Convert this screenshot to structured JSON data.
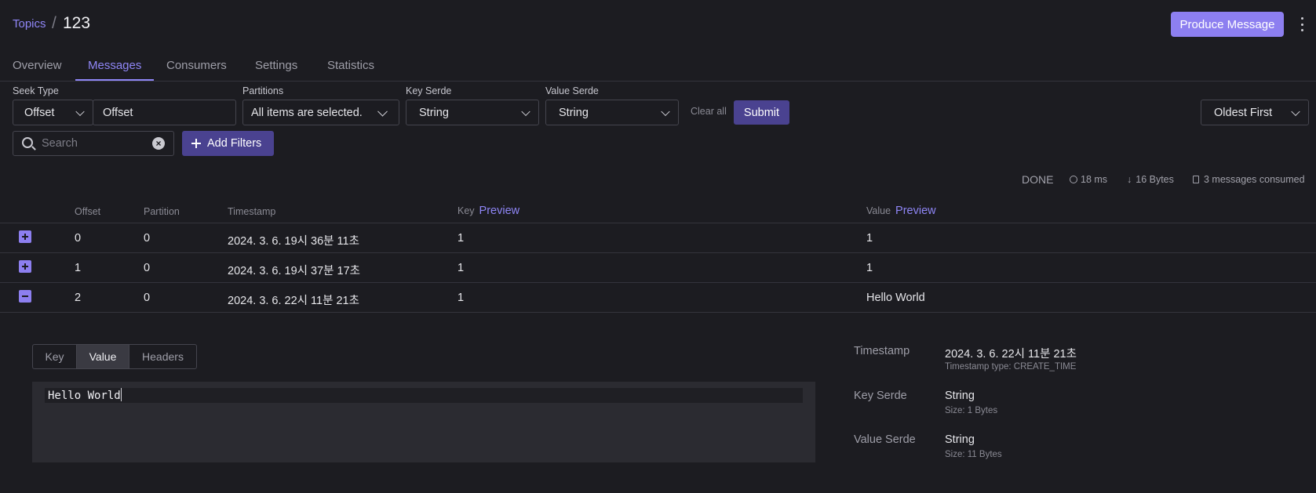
{
  "breadcrumb": {
    "parent": "Topics",
    "separator": "/",
    "current": "123"
  },
  "header": {
    "produce_label": "Produce Message"
  },
  "tabs": [
    "Overview",
    "Messages",
    "Consumers",
    "Settings",
    "Statistics"
  ],
  "active_tab": "Messages",
  "filters": {
    "seek_type_label": "Seek Type",
    "seek_type_value": "Offset",
    "offset_value": "Offset",
    "partitions_label": "Partitions",
    "partitions_value": "All items are selected.",
    "key_serde_label": "Key Serde",
    "key_serde_value": "String",
    "value_serde_label": "Value Serde",
    "value_serde_value": "String",
    "clear_all": "Clear all",
    "submit": "Submit",
    "sort_value": "Oldest First",
    "search_placeholder": "Search",
    "add_filters": "Add Filters"
  },
  "stats": {
    "status": "DONE",
    "elapsed": "18 ms",
    "bytes": "16 Bytes",
    "consumed": "3 messages consumed"
  },
  "table": {
    "headers": {
      "offset": "Offset",
      "partition": "Partition",
      "timestamp": "Timestamp",
      "key": "Key",
      "value": "Value",
      "preview": "Preview"
    },
    "rows": [
      {
        "offset": "0",
        "partition": "0",
        "timestamp": "2024. 3. 6. 19시 36분 11초",
        "key": "1",
        "value": "1",
        "expanded": false
      },
      {
        "offset": "1",
        "partition": "0",
        "timestamp": "2024. 3. 6. 19시 37분 17초",
        "key": "1",
        "value": "1",
        "expanded": false
      },
      {
        "offset": "2",
        "partition": "0",
        "timestamp": "2024. 3. 6. 22시 11분 21초",
        "key": "1",
        "value": "Hello World",
        "expanded": true
      }
    ]
  },
  "detail": {
    "tabs": [
      "Key",
      "Value",
      "Headers"
    ],
    "active_tab": "Value",
    "content": "Hello World",
    "timestamp_label": "Timestamp",
    "timestamp_value": "2024. 3. 6. 22시 11분 21초",
    "timestamp_type": "Timestamp type: CREATE_TIME",
    "key_serde_label": "Key Serde",
    "key_serde_value": "String",
    "key_size": "Size: 1 Bytes",
    "value_serde_label": "Value Serde",
    "value_serde_value": "String",
    "value_size": "Size: 11 Bytes"
  },
  "colors": {
    "accent": "#8d7ff0",
    "button_dark": "#4a4290",
    "background": "#1c1c21"
  }
}
